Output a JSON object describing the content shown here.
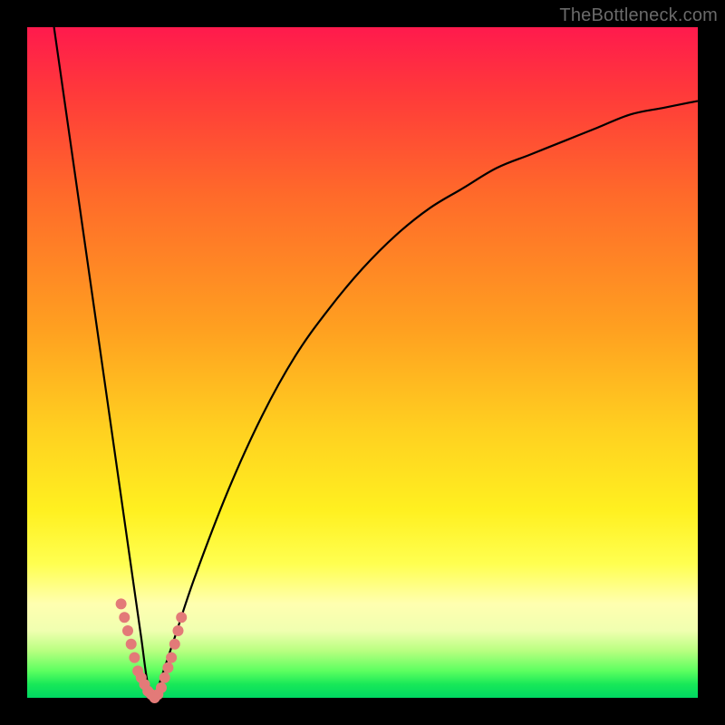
{
  "watermark": "TheBottleneck.com",
  "chart_data": {
    "type": "line",
    "title": "",
    "xlabel": "",
    "ylabel": "",
    "xlim": [
      0,
      100
    ],
    "ylim": [
      0,
      100
    ],
    "grid": false,
    "legend": false,
    "background_gradient": [
      "#ff1a4d",
      "#ff6a2a",
      "#ffd020",
      "#ffff50",
      "#5cff60",
      "#00d862"
    ],
    "series": [
      {
        "name": "bottleneck-curve",
        "color": "#000000",
        "x": [
          4,
          6,
          8,
          10,
          12,
          14,
          15,
          16,
          17,
          18,
          19,
          20,
          22,
          25,
          30,
          35,
          40,
          45,
          50,
          55,
          60,
          65,
          70,
          75,
          80,
          85,
          90,
          95,
          100
        ],
        "values": [
          100,
          86,
          72,
          58,
          44,
          30,
          23,
          16,
          9,
          2,
          0,
          3,
          9,
          18,
          31,
          42,
          51,
          58,
          64,
          69,
          73,
          76,
          79,
          81,
          83,
          85,
          87,
          88,
          89
        ]
      }
    ],
    "markers": {
      "name": "highlighted-points",
      "color": "#e37a78",
      "radius": 6,
      "points": [
        {
          "x": 14.0,
          "y": 14.0
        },
        {
          "x": 14.5,
          "y": 12.0
        },
        {
          "x": 15.0,
          "y": 10.0
        },
        {
          "x": 15.5,
          "y": 8.0
        },
        {
          "x": 16.0,
          "y": 6.0
        },
        {
          "x": 16.5,
          "y": 4.0
        },
        {
          "x": 17.0,
          "y": 3.0
        },
        {
          "x": 17.5,
          "y": 2.0
        },
        {
          "x": 18.0,
          "y": 1.0
        },
        {
          "x": 18.5,
          "y": 0.5
        },
        {
          "x": 19.0,
          "y": 0.0
        },
        {
          "x": 19.5,
          "y": 0.5
        },
        {
          "x": 20.0,
          "y": 1.5
        },
        {
          "x": 20.5,
          "y": 3.0
        },
        {
          "x": 21.0,
          "y": 4.5
        },
        {
          "x": 21.5,
          "y": 6.0
        },
        {
          "x": 22.0,
          "y": 8.0
        },
        {
          "x": 22.5,
          "y": 10.0
        },
        {
          "x": 23.0,
          "y": 12.0
        }
      ]
    }
  }
}
